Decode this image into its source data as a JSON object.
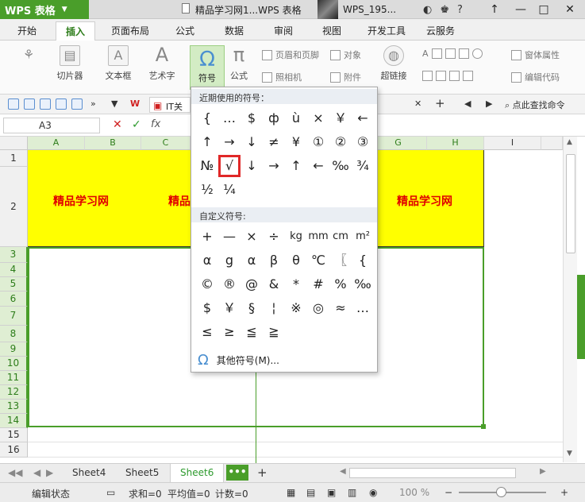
{
  "window": {
    "app_name": "WPS 表格",
    "title": "精品学习网1...WPS 表格",
    "user": "WPS_195...",
    "controls": [
      "↑",
      "—",
      "□",
      "✕"
    ]
  },
  "menu": {
    "tabs": [
      "开始",
      "插入",
      "页面布局",
      "公式",
      "数据",
      "审阅",
      "视图",
      "开发工具",
      "云服务"
    ],
    "active_tab": "插入"
  },
  "ribbon": {
    "clip_label": "切片器",
    "textbox_label": "文本框",
    "arttext_label": "艺术字",
    "symbol_label": "符号",
    "formula_label": "公式",
    "header_footer_label": "页眉和页脚",
    "camera_label": "照相机",
    "object_label": "对象",
    "attachment_label": "附件",
    "hyperlink_label": "超链接",
    "window_props_label": "窗体属性",
    "edit_code_label": "编辑代码"
  },
  "quickbar": {
    "doc_tab": "IT关键",
    "find_cmd": "点此查找命令"
  },
  "formula_bar": {
    "cell_ref": "A3",
    "fx": "fx"
  },
  "grid": {
    "columns": [
      "A",
      "B",
      "C",
      "G",
      "H",
      "I"
    ],
    "rows": [
      "1",
      "2",
      "3",
      "4",
      "5",
      "6",
      "7",
      "8",
      "9",
      "10",
      "11",
      "12",
      "13",
      "14",
      "15",
      "16"
    ],
    "cell_text": [
      "精品学习网",
      "精品",
      "精品学习网"
    ]
  },
  "symbols": {
    "recent_title": "近期使用的符号：",
    "recent": [
      "{",
      "…",
      "$",
      "ф",
      "ù",
      "×",
      "￥",
      "←",
      "↑",
      "→",
      "↓",
      "≠",
      "¥",
      "①",
      "②",
      "③",
      "№",
      "√",
      "↓",
      "→",
      "↑",
      "←",
      "‰",
      "¾",
      "½",
      "¼"
    ],
    "custom_title": "自定义符号:",
    "custom": [
      "+",
      "—",
      "×",
      "÷",
      "kg",
      "mm",
      "cm",
      "m²",
      "α",
      "g",
      "α",
      "β",
      "θ",
      "℃",
      "〖",
      "{",
      "©",
      "®",
      "@",
      "&",
      "*",
      "#",
      "%",
      "‰",
      "$",
      "￥",
      "§",
      "¦",
      "※",
      "◎",
      "≈",
      "…",
      "≤",
      "≥",
      "≦",
      "≧"
    ],
    "more_label": "其他符号(M)..."
  },
  "sheets": {
    "tabs": [
      "Sheet4",
      "Sheet5",
      "Sheet6"
    ],
    "active": "Sheet6",
    "more": "•••",
    "add": "+"
  },
  "status": {
    "edit_state": "编辑状态",
    "sum": "求和=0",
    "avg": "平均值=0",
    "count": "计数=0",
    "zoom": "100 %"
  }
}
